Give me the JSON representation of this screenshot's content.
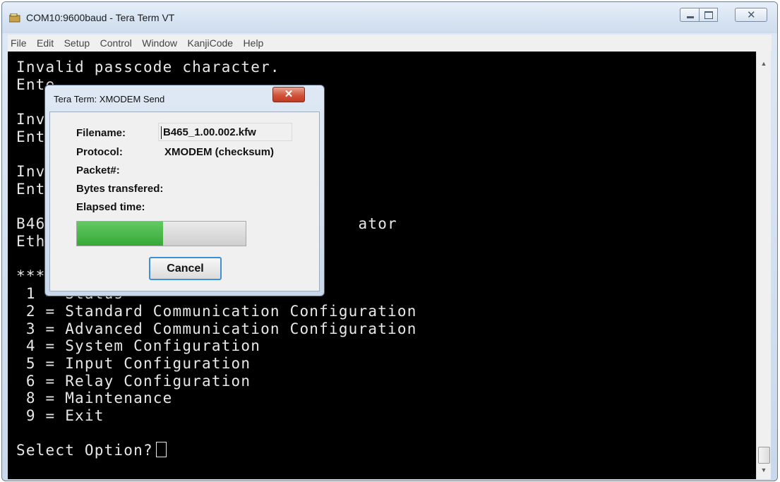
{
  "window": {
    "title": "COM10:9600baud - Tera Term VT",
    "controls": {
      "minimize": "minimize-icon",
      "maximize": "maximize-icon",
      "close": "close-icon"
    }
  },
  "menu": [
    "File",
    "Edit",
    "Setup",
    "Control",
    "Window",
    "KanjiCode",
    "Help"
  ],
  "terminal": {
    "lines": [
      "Invalid passcode character.",
      "Ente",
      "",
      "Inva",
      "Ente",
      "",
      "Inva",
      "Ente",
      "",
      "B465                               ator",
      "Ethe",
      "",
      "***",
      " 1 = Status",
      " 2 = Standard Communication Configuration",
      " 3 = Advanced Communication Configuration",
      " 4 = System Configuration",
      " 5 = Input Configuration",
      " 6 = Relay Configuration",
      " 8 = Maintenance",
      " 9 = Exit",
      "",
      "Select Option?"
    ]
  },
  "dialog": {
    "title": "Tera Term: XMODEM Send",
    "filename_label": "Filename:",
    "filename_value": "B465_1.00.002.kfw",
    "protocol_label": "Protocol:",
    "protocol_value": "XMODEM (checksum)",
    "packet_label": "Packet#:",
    "bytes_label": "Bytes transfered:",
    "elapsed_label": "Elapsed time:",
    "progress_fraction": 0.51,
    "cancel_label": "Cancel"
  }
}
